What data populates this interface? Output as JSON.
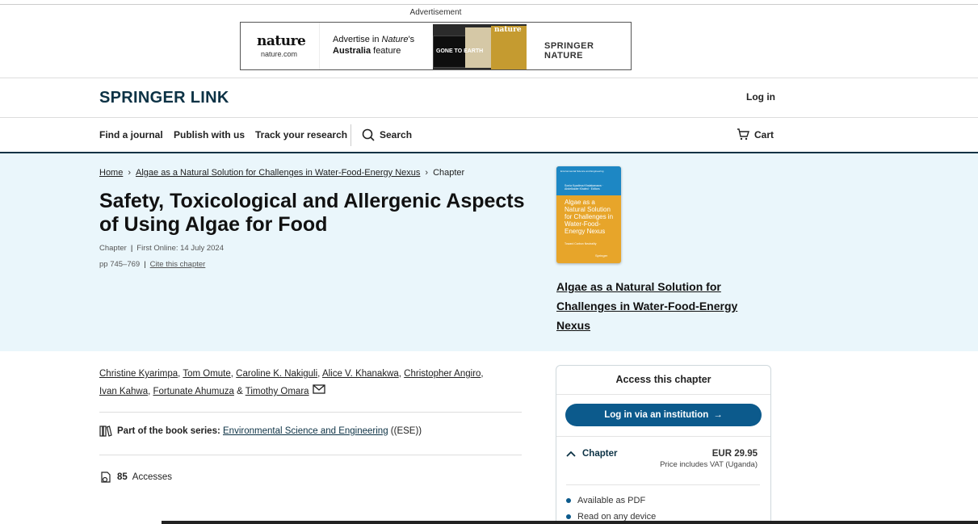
{
  "ad": {
    "label": "Advertisement",
    "nature_logo": "nature",
    "nature_url": "nature.com",
    "text_line1_a": "Advertise in ",
    "text_line1_b": "Nature",
    "text_line1_c": "'s",
    "text_line2_a": "Australia",
    "text_line2_b": " feature",
    "image_text_1": "GONE TO EARTH",
    "image_text_2": "nature",
    "springer_nature": "SPRINGER NATURE"
  },
  "header": {
    "brand": "SPRINGER LINK",
    "login": "Log in"
  },
  "nav": {
    "find_journal": "Find a journal",
    "publish": "Publish with us",
    "track": "Track your research",
    "search": "Search",
    "cart": "Cart"
  },
  "breadcrumb": {
    "home": "Home",
    "book": "Algae as a Natural Solution for Challenges in Water-Food-Energy Nexus",
    "current": "Chapter"
  },
  "chapter": {
    "title": "Safety, Toxicological and Allergenic Aspects of Using Algae for Food",
    "type": "Chapter",
    "first_online": "First Online: 14 July 2024",
    "pages": "pp 745–769",
    "cite": "Cite this chapter"
  },
  "book": {
    "cover_series": "Environmental Science and Engineering",
    "cover_editors": "Sonia Kyadima Khalakanawa · Abdelkader Khaled · Editors",
    "cover_title": "Algae as a Natural Solution for Challenges in Water-Food-Energy Nexus",
    "cover_subtitle": "Toward Carbon Neutrality",
    "cover_publisher": "Springer",
    "title": "Algae as a Natural Solution for Challenges in Water-Food-Energy Nexus"
  },
  "authors": {
    "list": [
      "Christine Kyarimpa",
      "Tom Omute",
      "Caroline K. Nakiguli",
      "Alice V. Khanakwa",
      "Christopher Angiro",
      "Ivan Kahwa",
      "Fortunate Ahumuza",
      "Timothy Omara"
    ],
    "sep": ", ",
    "and": " & "
  },
  "series": {
    "label": "Part of the book series:",
    "name": "Environmental Science and Engineering",
    "abbr": " ((ESE))"
  },
  "accesses": {
    "count": "85",
    "label": "Accesses"
  },
  "access_panel": {
    "heading": "Access this chapter",
    "institution_button": "Log in via an institution",
    "chapter_label": "Chapter",
    "price": "EUR 29.95",
    "vat": "Price includes VAT (Uganda)",
    "features": [
      "Available as PDF",
      "Read on any device"
    ]
  },
  "colors": {
    "brand": "#0c3245",
    "hero_bg": "#eaf6fb",
    "button": "#0c5a8c"
  }
}
